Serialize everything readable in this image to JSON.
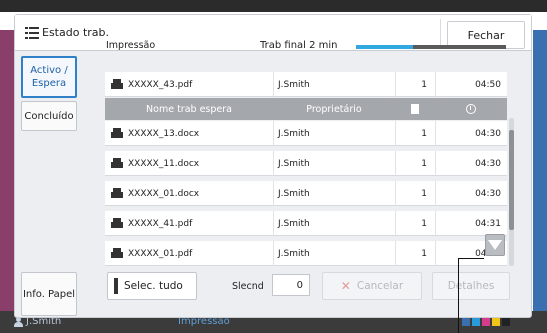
{
  "dialog": {
    "title": "Estado trab.",
    "close_label": "Fechar"
  },
  "nav": {
    "active_label": "Activo / Espera",
    "done_label": "Concluído",
    "paper_label": "Info. Papel"
  },
  "current": {
    "section_label": "Impressão",
    "eta_label": "Trab final 2 min",
    "progress": 0.38,
    "job": {
      "name": "XXXXX_43.pdf",
      "owner": "J.Smith",
      "copies": "1",
      "time": "04:50"
    }
  },
  "queue": {
    "columns": {
      "name": "Nome trab espera",
      "owner": "Proprietário"
    },
    "jobs": [
      {
        "name": "XXXXX_13.docx",
        "owner": "J.Smith",
        "copies": "1",
        "time": "04:30"
      },
      {
        "name": "XXXXX_11.docx",
        "owner": "J.Smith",
        "copies": "1",
        "time": "04:30"
      },
      {
        "name": "XXXXX_01.docx",
        "owner": "J.Smith",
        "copies": "1",
        "time": "04:30"
      },
      {
        "name": "XXXXX_41.pdf",
        "owner": "J.Smith",
        "copies": "1",
        "time": "04:31"
      },
      {
        "name": "XXXXX_01.pdf",
        "owner": "J.Smith",
        "copies": "1",
        "time": "04:31"
      }
    ]
  },
  "actions": {
    "select_all_label": "Selec. tudo",
    "selected_label": "Slecnd",
    "selected_count": "0",
    "cancel_label": "Cancelar",
    "details_label": "Detalhes"
  },
  "statusbar": {
    "user": "J.Smith",
    "state": "Impressão"
  },
  "colors": {
    "accent": "#2f7fc9",
    "progress": "#30a8e0",
    "ink": [
      "#3a6fb0",
      "#2a9bd8",
      "#d63c8c",
      "#f0c419",
      "#222222"
    ]
  },
  "icons": {
    "title": "list-icon",
    "job": "pc-icon",
    "copies_header": "document-icon",
    "time_header": "clock-icon",
    "scroll": "chevron-down-icon",
    "cancel": "x-icon"
  }
}
